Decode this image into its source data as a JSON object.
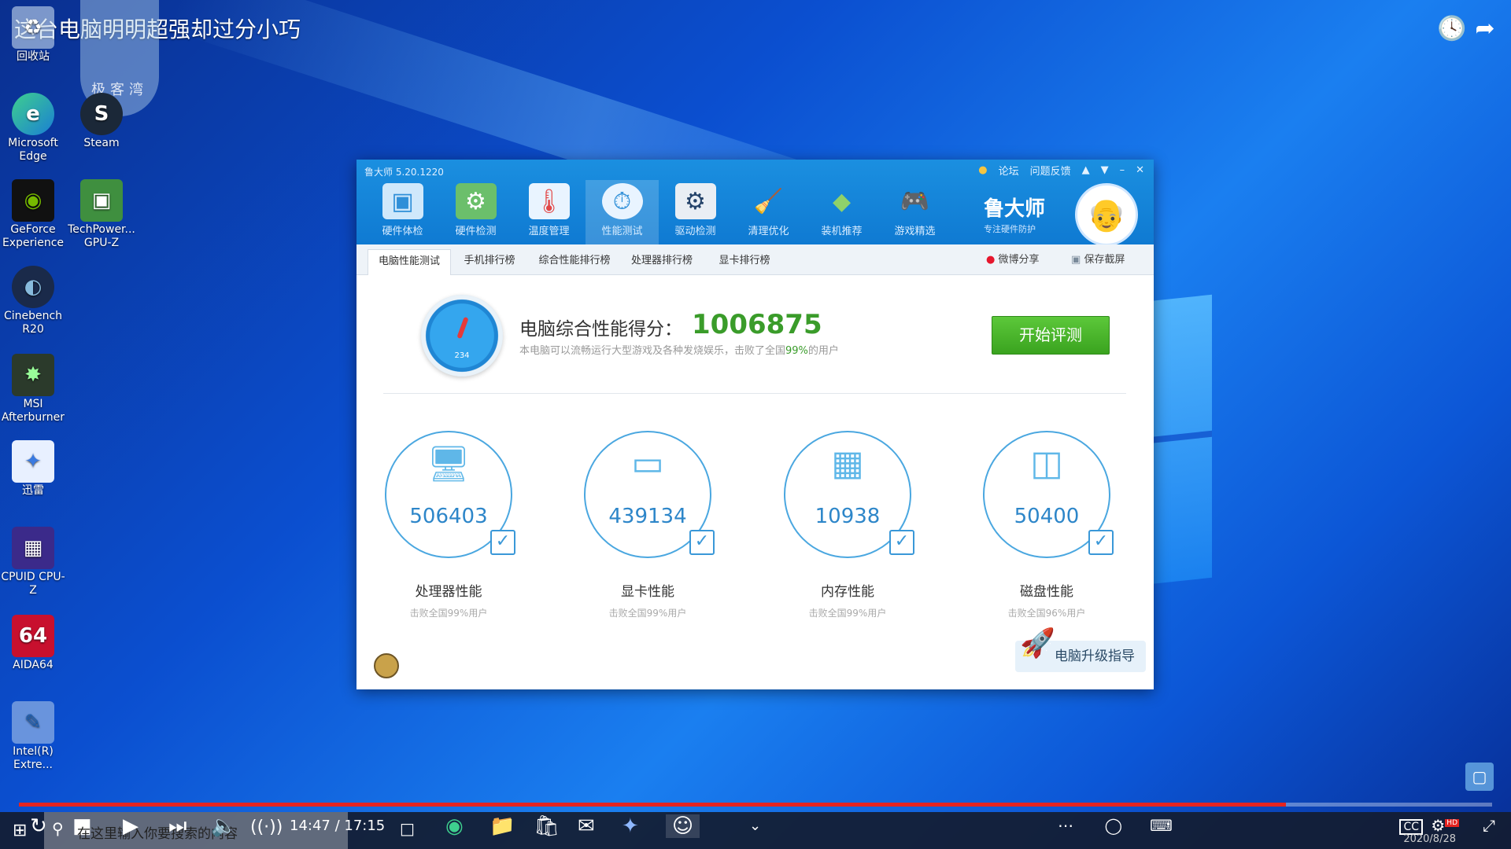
{
  "video": {
    "title": "这台电脑明明超强却过分小巧",
    "watermark": "极客湾",
    "time": "14:47 / 17:15",
    "progress_fraction": 0.86,
    "icons": [
      "clock-icon",
      "share-icon"
    ]
  },
  "desktop": {
    "icons": [
      {
        "label": "回收站",
        "icon": "recycle-bin-icon"
      },
      {
        "label": "Microsoft Edge",
        "icon": "edge-icon"
      },
      {
        "label": "Steam",
        "icon": "steam-icon"
      },
      {
        "label": "GeForce Experience",
        "icon": "geforce-icon"
      },
      {
        "label": "TechPower... GPU-Z",
        "icon": "gpu-z-icon"
      },
      {
        "label": "Cinebench R20",
        "icon": "cinebench-icon"
      },
      {
        "label": "MSI Afterburner",
        "icon": "afterburner-icon"
      },
      {
        "label": "迅雷",
        "icon": "xunlei-icon"
      },
      {
        "label": "CPUID CPU-Z",
        "icon": "cpu-z-icon"
      },
      {
        "label": "AIDA64",
        "icon": "aida64-icon"
      },
      {
        "label": "Intel(R) Extre...",
        "icon": "intel-xtu-icon"
      }
    ]
  },
  "app": {
    "title": "鲁大师 5.20.1220",
    "toolbar": {
      "forum": "论坛",
      "feedback": "问题反馈"
    },
    "nav": [
      {
        "label": "硬件体检",
        "icon": "hardware-check-icon"
      },
      {
        "label": "硬件检测",
        "icon": "hardware-detect-icon"
      },
      {
        "label": "温度管理",
        "icon": "thermometer-icon"
      },
      {
        "label": "性能测试",
        "icon": "speedometer-icon"
      },
      {
        "label": "驱动检测",
        "icon": "driver-gear-icon"
      },
      {
        "label": "清理优化",
        "icon": "broom-icon"
      },
      {
        "label": "装机推荐",
        "icon": "cube-icon"
      },
      {
        "label": "游戏精选",
        "icon": "gamepad-icon"
      }
    ],
    "brand": {
      "name": "鲁大师",
      "slogan": "专注硬件防护"
    },
    "subtabs": [
      "电脑性能测试",
      "手机排行榜",
      "综合性能排行榜",
      "处理器排行榜",
      "显卡排行榜"
    ],
    "share": {
      "weibo": "微博分享",
      "screenshot": "保存截屏"
    },
    "score": {
      "label": "电脑综合性能得分：",
      "value": "1006875",
      "desc_prefix": "本电脑可以流畅运行大型游戏及各种发烧娱乐，击败了全国",
      "desc_pct": "99%",
      "desc_suffix": "的用户",
      "gauge_number": "234"
    },
    "start_button": "开始评测",
    "metrics": [
      {
        "value": "506403",
        "label": "处理器性能",
        "sub": "击败全国99%用户",
        "icon": "monitor-cpu-icon"
      },
      {
        "value": "439134",
        "label": "显卡性能",
        "sub": "击败全国99%用户",
        "icon": "gpu-card-icon"
      },
      {
        "value": "10938",
        "label": "内存性能",
        "sub": "击败全国99%用户",
        "icon": "ram-chip-icon"
      },
      {
        "value": "50400",
        "label": "磁盘性能",
        "sub": "击败全国96%用户",
        "icon": "disk-drive-icon"
      }
    ],
    "upgrade": "电脑升级指导"
  },
  "taskbar": {
    "search_placeholder": "在这里输入你要搜索的内容",
    "date": "2020/8/28"
  },
  "colors": {
    "score_green": "#3a9c2a",
    "accent_blue": "#1b8fe0",
    "progress_red": "#e52420"
  }
}
